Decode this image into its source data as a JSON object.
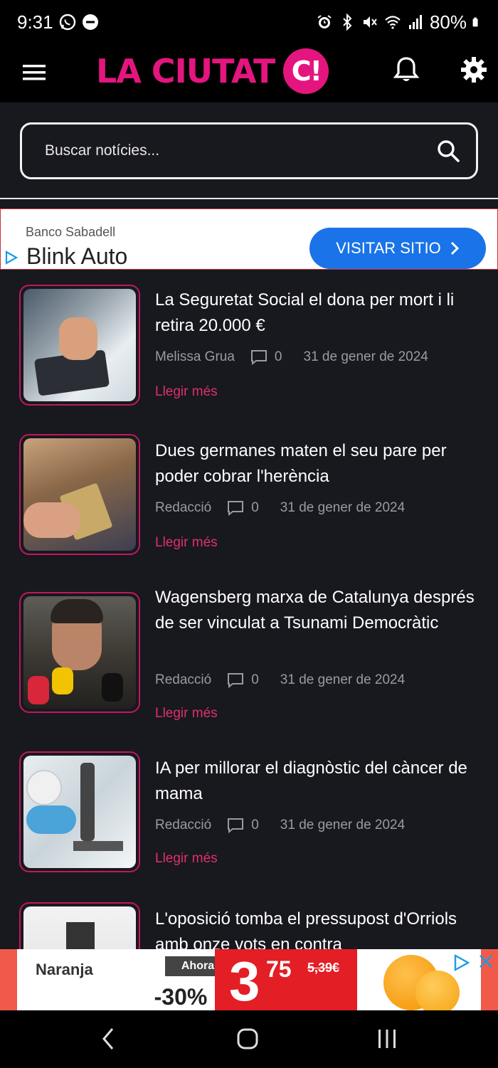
{
  "status_bar": {
    "time": "9:31",
    "battery": "80%"
  },
  "header": {
    "logo_text": "LA CIUTAT",
    "logo_badge": "C!"
  },
  "search": {
    "placeholder": "Buscar notícies..."
  },
  "ad_top": {
    "brand": "Banco Sabadell",
    "title": "Blink Auto",
    "button": "VISITAR SITIO",
    "button_color": "#1a73e8"
  },
  "articles": [
    {
      "title": "La Seguretat Social el dona per mort i li retira 20.000 €",
      "author": "Melissa Grua",
      "comments": "0",
      "date": "31 de gener de 2024",
      "read_more": "Llegir més"
    },
    {
      "title": "Dues germanes maten el seu pare per poder cobrar l'herència",
      "author": "Redacció",
      "comments": "0",
      "date": "31 de gener de 2024",
      "read_more": "Llegir més"
    },
    {
      "title": "Wagensberg marxa de Catalunya després de ser vinculat a Tsunami Democràtic",
      "author": "Redacció",
      "comments": "0",
      "date": "31 de gener de 2024",
      "read_more": "Llegir més"
    },
    {
      "title": "IA per millorar el diagnòstic del càncer de mama",
      "author": "Redacció",
      "comments": "0",
      "date": "31 de gener de 2024",
      "read_more": "Llegir més"
    },
    {
      "title": "L'oposició tomba el pressupost d'Orriols amb onze vots en contra"
    }
  ],
  "ad_bottom": {
    "product": "Naranja",
    "label": "Ahora",
    "discount": "-30%",
    "price_int": "3",
    "price_dec": "75",
    "old_price": "5,39€"
  },
  "colors": {
    "accent": "#e4157f",
    "background": "#18181f",
    "read_more": "#e0306b"
  }
}
